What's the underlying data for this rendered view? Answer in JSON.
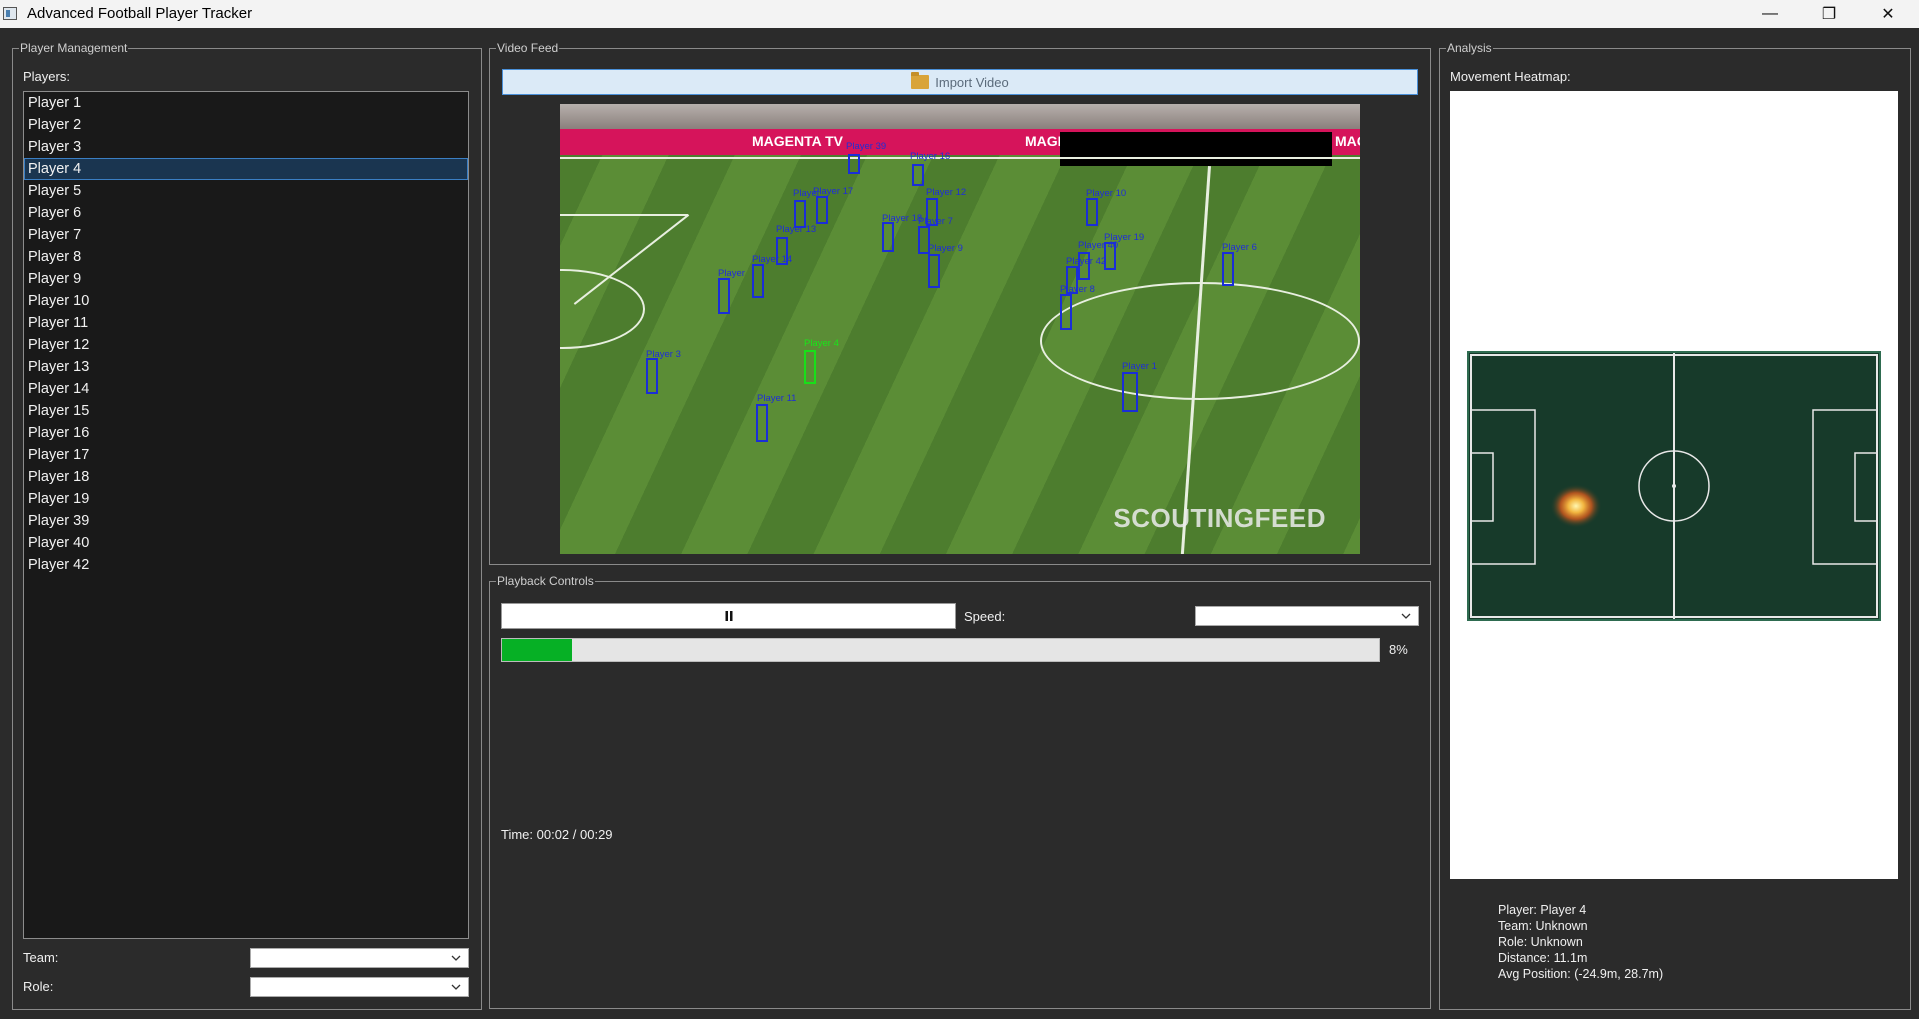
{
  "window": {
    "title": "Advanced Football Player Tracker",
    "minimize_glyph": "—",
    "maximize_glyph": "❐",
    "close_glyph": "✕"
  },
  "player_management": {
    "group_title": "Player Management",
    "players_label": "Players:",
    "players": [
      "Player 1",
      "Player 2",
      "Player 3",
      "Player 4",
      "Player 5",
      "Player 6",
      "Player 7",
      "Player 8",
      "Player 9",
      "Player 10",
      "Player 11",
      "Player 12",
      "Player 13",
      "Player 14",
      "Player 15",
      "Player 16",
      "Player 17",
      "Player 18",
      "Player 19",
      "Player 39",
      "Player 40",
      "Player 42"
    ],
    "selected_player": "Player 4",
    "team_label": "Team:",
    "team_value": "",
    "role_label": "Role:",
    "role_value": ""
  },
  "video_feed": {
    "group_title": "Video Feed",
    "import_button": "Import Video",
    "ad_text": [
      "MAGENTA TV",
      "MAGE",
      "MAG"
    ],
    "watermark": "SCOUTINGFEED",
    "player_tags": [
      {
        "label": "Player 39"
      },
      {
        "label": "Player 16"
      },
      {
        "label": "Player 17"
      },
      {
        "label": "Player"
      },
      {
        "label": "Player 12"
      },
      {
        "label": "Player 10"
      },
      {
        "label": "Player 13"
      },
      {
        "label": "Player 18"
      },
      {
        "label": "Player 7"
      },
      {
        "label": "Player 9"
      },
      {
        "label": "Player 19"
      },
      {
        "label": "Player 40"
      },
      {
        "label": "Player 42"
      },
      {
        "label": "Player 6"
      },
      {
        "label": "Player 14"
      },
      {
        "label": "Player"
      },
      {
        "label": "Player 8"
      },
      {
        "label": "Player 4"
      },
      {
        "label": "Player 3"
      },
      {
        "label": "Player 1"
      },
      {
        "label": "Player 11"
      }
    ]
  },
  "playback": {
    "group_title": "Playback Controls",
    "speed_label": "Speed:",
    "speed_value": "",
    "progress_percent": 8,
    "progress_text": "8%",
    "time_text": "Time: 00:02 / 00:29"
  },
  "analysis": {
    "group_title": "Analysis",
    "heatmap_label": "Movement Heatmap:",
    "info": {
      "player": "Player: Player 4",
      "team": "Team: Unknown",
      "role": "Role: Unknown",
      "distance": "Distance: 11.1m",
      "avg_position": "Avg Position: (-24.9m, 28.7m)"
    }
  },
  "colors": {
    "background": "#2b2b2b",
    "list_background": "#191919",
    "selection": "#1a3550",
    "progress": "#06b025",
    "pitch": "#173a2a",
    "tracking_box": "#1a2ed8",
    "selected_box": "#18e018"
  }
}
